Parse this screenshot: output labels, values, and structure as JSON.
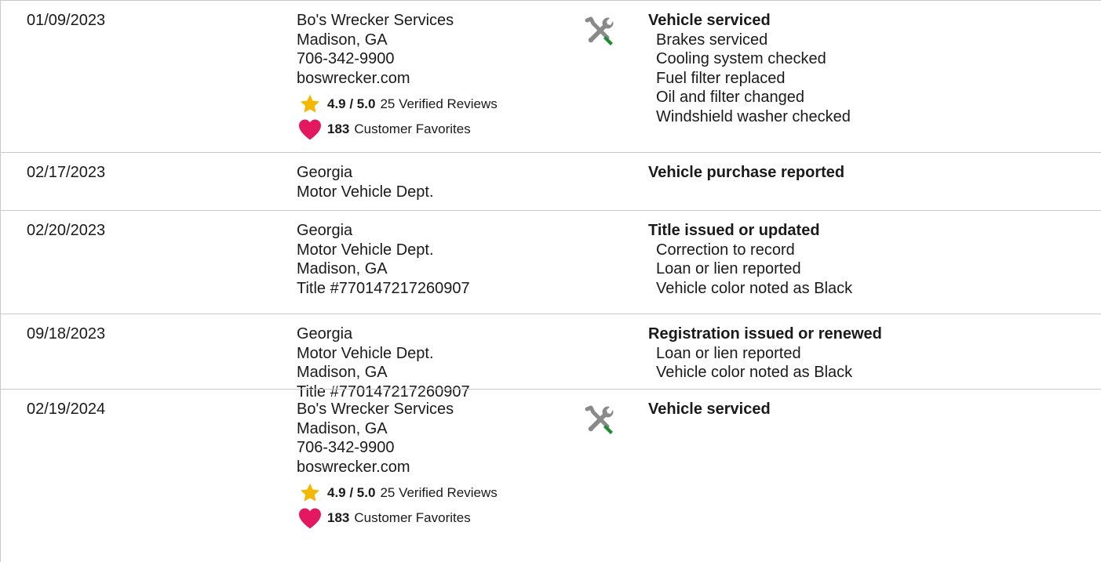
{
  "colors": {
    "border": "#c9c9c9",
    "star": "#f5b800",
    "heart": "#e3185f",
    "tool_handle": "#1e8a3a",
    "tool_metal": "#8a8a8a"
  },
  "records": [
    {
      "date": "01/09/2023",
      "source": [
        "Bo's Wrecker Services",
        "Madison, GA",
        "706-342-9900",
        "boswrecker.com"
      ],
      "rating": {
        "score": "4.9 / 5.0",
        "reviews": "25 Verified Reviews"
      },
      "favorites": {
        "count": "183",
        "label": "Customer Favorites"
      },
      "icon": "wrench-screwdriver-icon",
      "title": "Vehicle serviced",
      "items": [
        "Brakes serviced",
        "Cooling system checked",
        "Fuel filter replaced",
        "Oil and filter changed",
        "Windshield washer checked"
      ]
    },
    {
      "date": "02/17/2023",
      "source": [
        "Georgia",
        "Motor Vehicle Dept."
      ],
      "title": "Vehicle purchase reported",
      "items": []
    },
    {
      "date": "02/20/2023",
      "source": [
        "Georgia",
        "Motor Vehicle Dept.",
        "Madison, GA",
        "Title #770147217260907"
      ],
      "title": "Title issued or updated",
      "items": [
        "Correction to record",
        "Loan or lien reported",
        "Vehicle color noted as Black"
      ]
    },
    {
      "date": "09/18/2023",
      "source": [
        "Georgia",
        "Motor Vehicle Dept.",
        "Madison, GA",
        "Title #770147217260907"
      ],
      "title": "Registration issued or renewed",
      "items": [
        "Loan or lien reported",
        "Vehicle color noted as Black"
      ]
    },
    {
      "date": "02/19/2024",
      "source": [
        "Bo's Wrecker Services",
        "Madison, GA",
        "706-342-9900",
        "boswrecker.com"
      ],
      "rating": {
        "score": "4.9 / 5.0",
        "reviews": "25 Verified Reviews"
      },
      "favorites": {
        "count": "183",
        "label": "Customer Favorites"
      },
      "icon": "wrench-screwdriver-icon",
      "title": "Vehicle serviced",
      "items": []
    }
  ]
}
